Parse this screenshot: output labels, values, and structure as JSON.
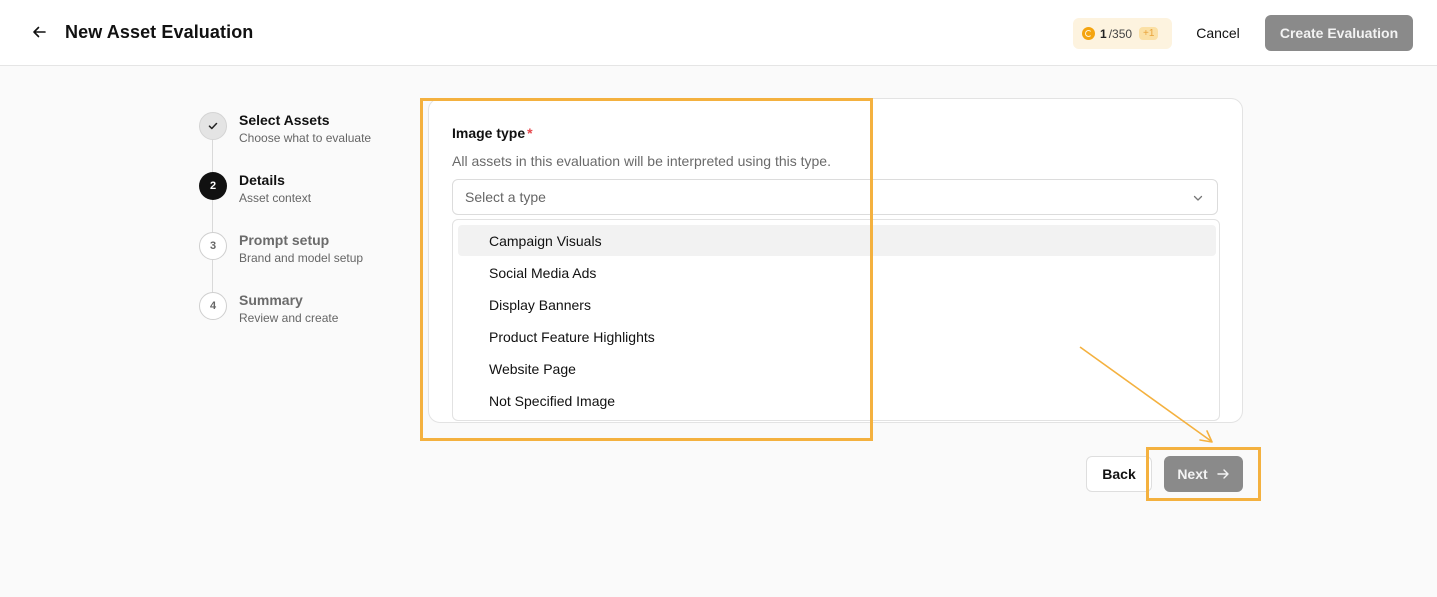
{
  "header": {
    "title": "New Asset Evaluation",
    "credits_used": "1",
    "credits_total": "/350",
    "credits_badge": "+1",
    "cancel_label": "Cancel",
    "create_label": "Create Evaluation"
  },
  "steps": [
    {
      "number": "",
      "title": "Select Assets",
      "subtitle": "Choose what to evaluate",
      "state": "done"
    },
    {
      "number": "2",
      "title": "Details",
      "subtitle": "Asset context",
      "state": "active"
    },
    {
      "number": "3",
      "title": "Prompt setup",
      "subtitle": "Brand and model setup",
      "state": "pending"
    },
    {
      "number": "4",
      "title": "Summary",
      "subtitle": "Review and create",
      "state": "pending"
    }
  ],
  "form": {
    "image_type_label": "Image type",
    "required_mark": "*",
    "help_text": "All assets in this evaluation will be interpreted using this type.",
    "select_placeholder": "Select a type",
    "options": [
      "Campaign Visuals",
      "Social Media Ads",
      "Display Banners",
      "Product Feature Highlights",
      "Website Page",
      "Not Specified Image"
    ]
  },
  "nav": {
    "back_label": "Back",
    "next_label": "Next"
  },
  "colors": {
    "highlight": "#f4b13f",
    "primary_disabled": "#8a8a8a",
    "credit_coin": "#f4a40f"
  }
}
